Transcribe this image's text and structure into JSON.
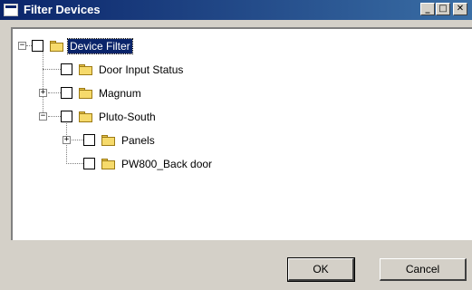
{
  "window": {
    "title": "Filter Devices",
    "minimize_glyph": "_",
    "maximize_glyph": "□",
    "close_glyph": "✕"
  },
  "tree": {
    "root": {
      "label": "Device Filter",
      "expanded": true,
      "checked": false,
      "selected": true,
      "children": [
        {
          "label": "Door Input Status",
          "checked": false,
          "has_children": false
        },
        {
          "label": "Magnum",
          "checked": false,
          "has_children": true,
          "expanded": false
        },
        {
          "label": "Pluto-South",
          "checked": false,
          "has_children": true,
          "expanded": true,
          "children": [
            {
              "label": "Panels",
              "checked": false,
              "has_children": true,
              "expanded": false
            },
            {
              "label": "PW800_Back door",
              "checked": false,
              "has_children": false
            }
          ]
        }
      ]
    },
    "expander_collapsed_glyph": "+",
    "expander_expanded_glyph": "−"
  },
  "buttons": {
    "ok_label": "OK",
    "cancel_label": "Cancel"
  },
  "colors": {
    "title_bar_start": "#0a246a",
    "title_bar_end": "#3a6ea5",
    "selection": "#0a246a",
    "dialog_face": "#d4d0c8",
    "folder": "#f6da6b"
  }
}
